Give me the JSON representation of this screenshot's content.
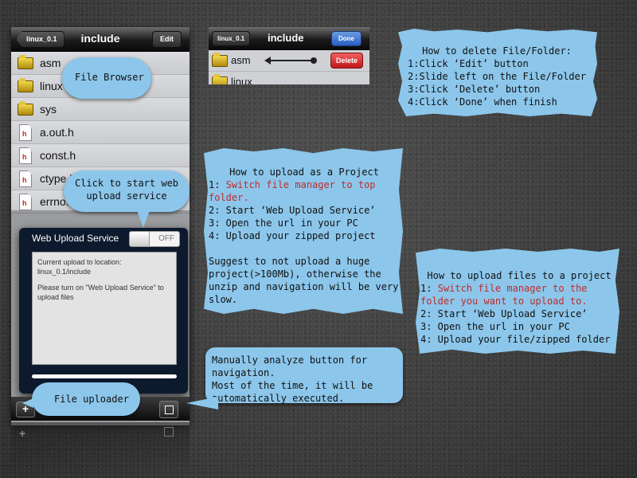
{
  "file_browser": {
    "back_label": "linux_0.1",
    "title": "include",
    "edit_label": "Edit",
    "files": [
      {
        "name": "asm",
        "type": "folder"
      },
      {
        "name": "linux",
        "type": "folder"
      },
      {
        "name": "sys",
        "type": "folder"
      },
      {
        "name": "a.out.h",
        "type": "header"
      },
      {
        "name": "const.h",
        "type": "header"
      },
      {
        "name": "ctype.h",
        "type": "header"
      },
      {
        "name": "errno.h",
        "type": "header"
      }
    ],
    "header_icon_letter": "h"
  },
  "upload_popover": {
    "title": "Web Upload Service",
    "toggle_state": "OFF",
    "location_label": "Current upload to location:",
    "location_value": "linux_0.1/include",
    "message": "Please turn on \"Web Upload Service\" to upload files"
  },
  "toolbar": {
    "add_label": "+"
  },
  "delete_demo": {
    "back_label": "linux_0.1",
    "title": "include",
    "done_label": "Done",
    "row1": "asm",
    "row2": "linux",
    "delete_label": "Delete"
  },
  "callouts": {
    "file_browser": "File Browser",
    "upload_service": "Click to start web upload service",
    "file_uploader": "File uploader",
    "analyze": "Manually analyze button for navigation.\nMost of the time, it will be automatically executed."
  },
  "notes": {
    "delete": {
      "title": "How to delete File/Folder:",
      "steps": [
        "1:Click ‘Edit’ button",
        "2:Slide left on the File/Folder",
        "3:Click ‘Delete’ button",
        "4:Click ‘Done’ when finish"
      ]
    },
    "project": {
      "title": "How to upload as a Project",
      "step1_num": "1: ",
      "step1": "Switch file manager to top folder.",
      "step2": "2: Start ‘Web Upload Service’",
      "step3": "3: Open the url in your PC",
      "step4": "4: Upload your zipped project",
      "suggestion": "Suggest to not upload a huge project(>100Mb), otherwise the unzip and navigation will be very slow."
    },
    "files": {
      "title": "How to upload files to a project",
      "step1_num": "1: ",
      "step1": "Switch file manager to the folder you want to upload to.",
      "step2": "2: Start ‘Web Upload Service’",
      "step3": "3: Open the url in your PC",
      "step4": "4: Upload your file/zipped folder"
    }
  },
  "colors": {
    "callout": "#8cc6ea",
    "highlight_text": "#c02c2c",
    "delete_button": "#d42a2a",
    "done_button": "#3a6fd0"
  }
}
